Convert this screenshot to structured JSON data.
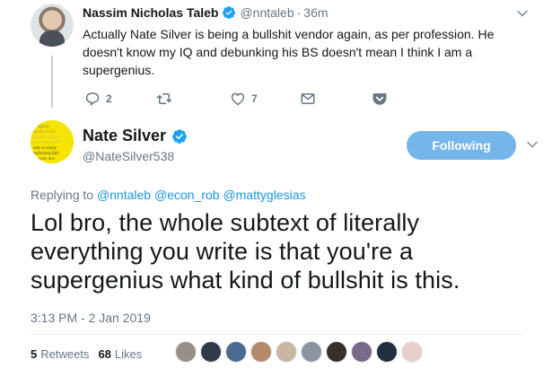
{
  "parent_tweet": {
    "name": "Nassim Nicholas Taleb",
    "handle": "@nntaleb",
    "separator": "·",
    "time": "36m",
    "text": "Actually Nate Silver is being a bullshit vendor again, as per profession. He doesn't know my IQ and debunking his BS doesn't mean I think I am a supergenius.",
    "actions": {
      "reply_count": "2",
      "retweet_count": "",
      "like_count": "7"
    }
  },
  "main_tweet": {
    "name": "Nate Silver",
    "handle": "@NateSilver538",
    "follow_label": "Following",
    "replying_prefix": "Replying to",
    "replying_to": [
      "@nntaleb",
      "@econ_rob",
      "@mattyglesias"
    ],
    "avatar_text": [
      "signal",
      "nd the noise",
      "he noise and the",
      "noise and the no",
      "why so many",
      "redictions fail",
      "some don"
    ],
    "text": "Lol bro, the whole subtext of literally everything you write is that you're a supergenius what kind of bullshit is this.",
    "timestamp": "3:13 PM - 2 Jan 2019",
    "stats": {
      "retweets_count": "5",
      "retweets_label": "Retweets",
      "likes_count": "68",
      "likes_label": "Likes"
    },
    "liker_avatar_colors": [
      "#9a8f86",
      "#2f3b4c",
      "#4b6a8f",
      "#b58a6a",
      "#c9b6a3",
      "#8c96a3",
      "#3a2f2a",
      "#7a6a8a",
      "#20303f",
      "#e8d0c8"
    ]
  },
  "colors": {
    "accent": "#1b95e0",
    "follow_button": "#74b6ea",
    "secondary_text": "#657786",
    "verified": "#1da1f2"
  }
}
